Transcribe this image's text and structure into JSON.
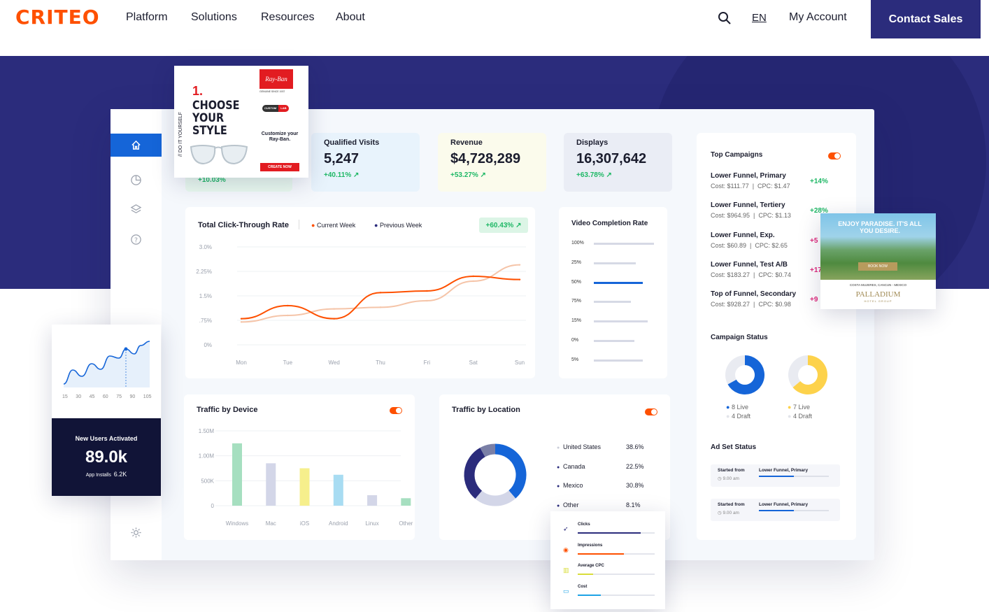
{
  "nav": {
    "logo": "CRITEO",
    "links": [
      "Platform",
      "Solutions",
      "Resources",
      "About"
    ],
    "lang": "EN",
    "account": "My Account",
    "contact": "Contact Sales"
  },
  "kpis": [
    {
      "title": "Qualified Visits",
      "value": "5,247",
      "change": "+40.11%"
    },
    {
      "title": "Revenue",
      "value": "$4,728,289",
      "change": "+53.27%"
    },
    {
      "title": "Displays",
      "value": "16,307,642",
      "change": "+63.78%"
    }
  ],
  "hidden_kpi_change": "+10.03%",
  "ctr": {
    "title": "Total Click-Through Rate",
    "legend_current": "Current Week",
    "legend_previous": "Previous Week",
    "badge": "+60.43%",
    "colors": {
      "current": "#fe5000",
      "previous": "#f5c4a8"
    },
    "chart_data": {
      "type": "line",
      "categories": [
        "Mon",
        "Tue",
        "Wed",
        "Thu",
        "Fri",
        "Sat",
        "Sun"
      ],
      "y_ticks": [
        "3.0%",
        "2.25%",
        "1.5%",
        ".75%",
        "0%"
      ],
      "ylim": [
        0,
        3.0
      ],
      "series": [
        {
          "name": "Current Week",
          "values": [
            0.8,
            1.2,
            0.8,
            1.6,
            1.65,
            2.1,
            2.0
          ]
        },
        {
          "name": "Previous Week",
          "values": [
            0.7,
            0.9,
            1.1,
            1.15,
            1.35,
            1.95,
            2.45
          ]
        }
      ]
    }
  },
  "vcr": {
    "title": "Video Completion Rate",
    "rows": [
      {
        "label": "100%",
        "fill": 0.98
      },
      {
        "label": "25%",
        "fill": 0.68
      },
      {
        "label": "50%",
        "fill": 0.8,
        "active": true
      },
      {
        "label": "75%",
        "fill": 0.6
      },
      {
        "label": "15%",
        "fill": 0.88
      },
      {
        "label": "0%",
        "fill": 0.66
      },
      {
        "label": "5%",
        "fill": 0.8
      }
    ]
  },
  "device": {
    "title": "Traffic by Device",
    "chart_data": {
      "type": "bar",
      "categories": [
        "Windows",
        "Mac",
        "iOS",
        "Android",
        "Linux",
        "Other"
      ],
      "values": [
        1.25,
        0.85,
        0.75,
        0.62,
        0.21,
        0.15
      ],
      "colors": [
        "#a6dfc0",
        "#d3d6e8",
        "#f6ef8c",
        "#a8dcf2",
        "#d3d6e8",
        "#a6dfc0"
      ],
      "y_ticks": [
        "1.50M",
        "1.00M",
        "500K",
        "0"
      ],
      "ylim": [
        0,
        1.5
      ],
      "unit": "M"
    }
  },
  "location": {
    "title": "Traffic by Location",
    "rows": [
      {
        "name": "United States",
        "value": "38.6%"
      },
      {
        "name": "Canada",
        "value": "22.5%"
      },
      {
        "name": "Mexico",
        "value": "30.8%"
      },
      {
        "name": "Other",
        "value": "8.1%"
      }
    ],
    "chart_data": {
      "type": "pie",
      "categories": [
        "United States",
        "Canada",
        "Mexico",
        "Other"
      ],
      "values": [
        38.6,
        22.5,
        30.8,
        8.1
      ],
      "colors": [
        "#1565d8",
        "#d3d6e8",
        "#2b2c7c",
        "#7a7fa6"
      ]
    }
  },
  "top_campaigns": {
    "title": "Top Campaigns",
    "items": [
      {
        "name": "Lower Funnel, Primary",
        "detail": "Cost: $111.77  |  CPC: $1.47",
        "change": "+14%"
      },
      {
        "name": "Lower Funnel, Tertiery",
        "detail": "Cost: $964.95  |  CPC: $1.13",
        "change": "+28%"
      },
      {
        "name": "Lower Funnel, Exp.",
        "detail": "Cost: $60.89  |  CPC: $2.65",
        "change": "+5"
      },
      {
        "name": "Lower Funnel, Test A/B",
        "detail": "Cost: $183.27  |  CPC: $0.74",
        "change": "+17"
      },
      {
        "name": "Top of Funnel, Secondary",
        "detail": "Cost: $928.27  |  CPC: $0.98",
        "change": "+9"
      }
    ]
  },
  "campaign_status": {
    "title": "Campaign Status",
    "donuts": [
      {
        "live": "8 Live",
        "draft": "4 Draft",
        "live_fraction": 0.67,
        "color": "#1565d8"
      },
      {
        "live": "7 Live",
        "draft": "4 Draft",
        "live_fraction": 0.64,
        "color": "#fdd24b"
      }
    ]
  },
  "ad_set_status": {
    "title": "Ad Set Status",
    "items": [
      {
        "started": "Started from",
        "time": "9.00 am",
        "name": "Lower Funnel, Primary",
        "progress": 0.5
      },
      {
        "started": "Started from",
        "time": "9.00 am",
        "name": "Lower Funnel, Primary",
        "progress": 0.5
      }
    ]
  },
  "users_card": {
    "x_ticks": [
      "15",
      "30",
      "45",
      "60",
      "75",
      "90",
      "105"
    ],
    "title": "New Users Activated",
    "value": "89.0k",
    "installs_label": "App Installs",
    "installs_value": "6.2K"
  },
  "metrics_card": {
    "items": [
      {
        "label": "Clicks",
        "progress": 0.82,
        "color": "#2b2c7c",
        "icon": "rocket-icon"
      },
      {
        "label": "Impressions",
        "progress": 0.6,
        "color": "#fe5000",
        "icon": "eye-icon"
      },
      {
        "label": "Average CPC",
        "progress": 0.2,
        "color": "#d9dd3a",
        "icon": "chart-icon"
      },
      {
        "label": "Cost",
        "progress": 0.3,
        "color": "#1ea3e6",
        "icon": "card-icon"
      }
    ]
  },
  "rayban_ad": {
    "num": "1.",
    "headline": [
      "CHOOSE",
      "YOUR",
      "STYLE"
    ],
    "side": "// DO IT YOURSELF",
    "brand": "Ray-Ban",
    "tagline": "GENUINE SINCE 1937",
    "custom": "CUSTOM",
    "lab": "LAB",
    "customize": "Customize your Ray-Ban.",
    "cta": "CREATE NOW"
  },
  "resort_ad": {
    "headline": "ENJOY PARADISE. IT'S ALL YOU DESIRE.",
    "cta": "BOOK NOW",
    "location": "COSTA MUJERES, CANCUN - MEXICO",
    "brand": "PALLADIUM",
    "sub": "HOTEL GROUP"
  }
}
